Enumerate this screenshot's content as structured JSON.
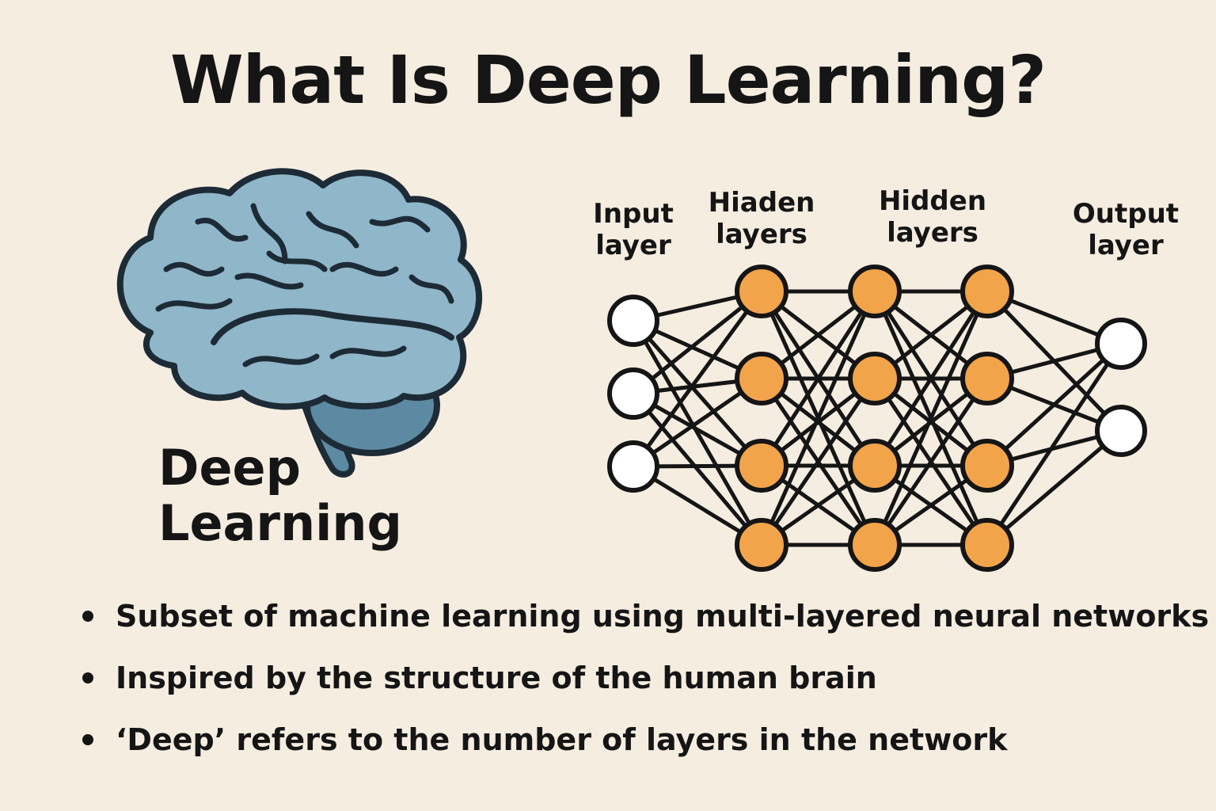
{
  "title": "What Is Deep Learning?",
  "brain": {
    "icon": "brain-icon",
    "caption_line1": "Deep",
    "caption_line2": "Learning",
    "fill_color": "#8fb6c9",
    "stem_color": "#5d8aa3"
  },
  "network": {
    "labels": {
      "input": [
        "Input",
        "layer"
      ],
      "hidden1": [
        "Hiaden",
        "layers"
      ],
      "hidden2": [
        "Hidden layers"
      ],
      "output": [
        "Output",
        "layer"
      ]
    },
    "layer_sizes": [
      3,
      4,
      4,
      4,
      2
    ],
    "input_node_color": "#ffffff",
    "hidden_node_color": "#f2a44a",
    "output_node_color": "#ffffff"
  },
  "bullets": [
    "Subset of machine learning using multi-layered neural networks",
    "Inspired by the structure of the human brain",
    "‘Deep’ refers to the number of layers in the network"
  ]
}
